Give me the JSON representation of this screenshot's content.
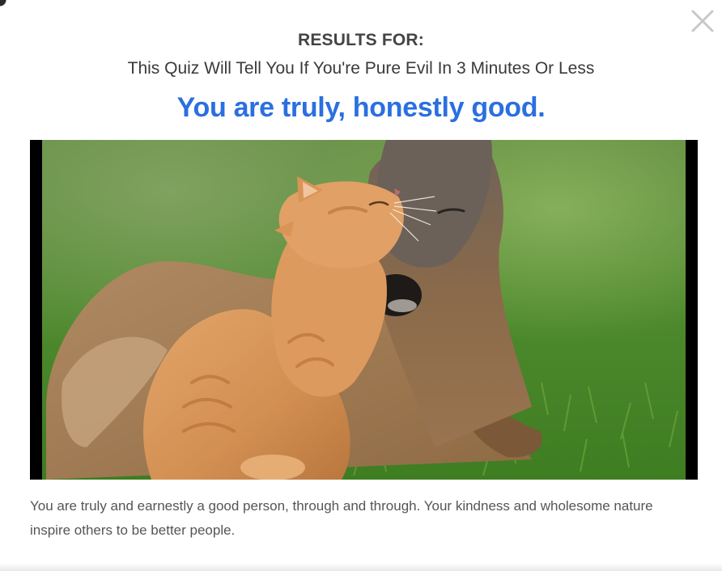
{
  "modal": {
    "heading": "RESULTS FOR:",
    "quiz_title": "This Quiz Will Tell You If You're Pure Evil In 3 Minutes Or Less",
    "result_title": "You are truly, honestly good.",
    "description": "You are truly and earnestly a good person, through and through. Your kindness and wholesome nature inspire others to be better people.",
    "close_icon": "close-icon",
    "image_subject": "orange-cat-nuzzling-fawn-on-grass"
  },
  "colors": {
    "accent": "#2b6fe0",
    "heading_text": "#444444",
    "body_text": "#555555",
    "close_icon": "#c8c8c8"
  }
}
